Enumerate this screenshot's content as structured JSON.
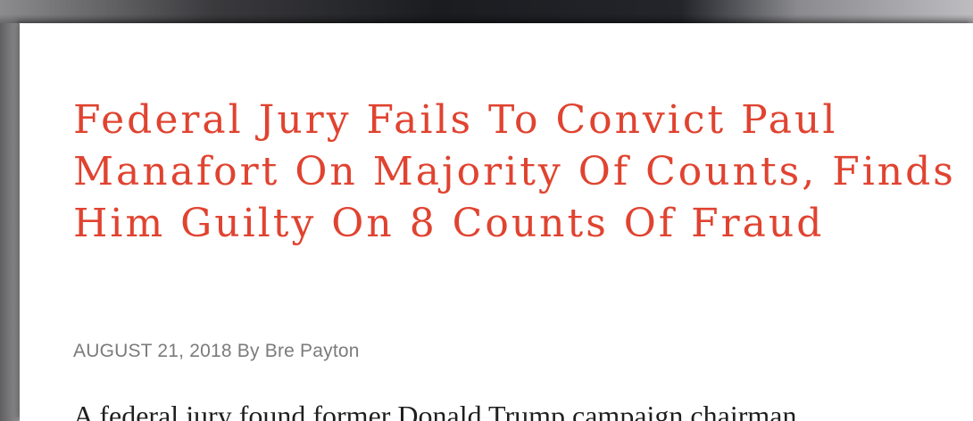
{
  "article": {
    "title": "Federal Jury Fails To Convict Paul Manafort On Majority Of Counts, Finds Him Guilty On 8 Counts Of Fraud",
    "date": "AUGUST 21, 2018",
    "byline_prefix": "By",
    "author": "Bre Payton",
    "body_first_line": "A federal jury found former Donald Trump campaign chairman"
  },
  "colors": {
    "title": "#e04330",
    "byline": "#7b7b7b",
    "body": "#1f1f1f"
  }
}
